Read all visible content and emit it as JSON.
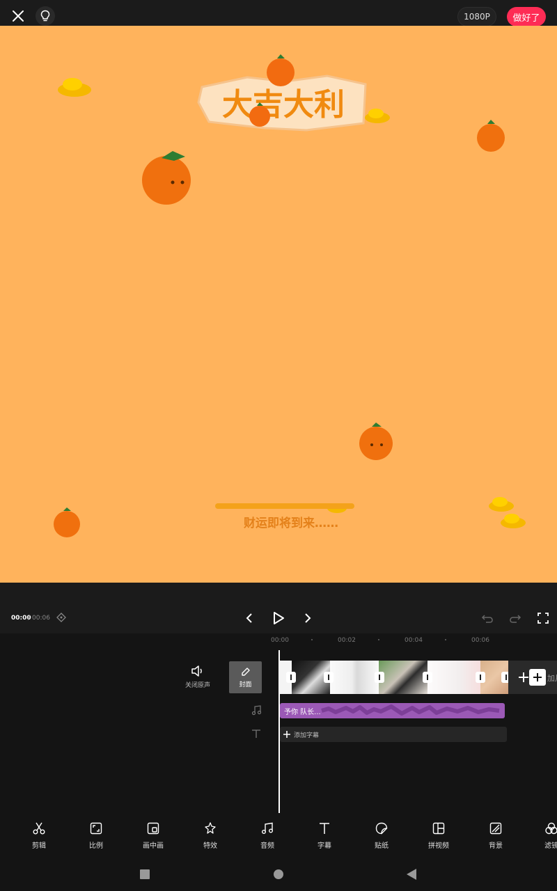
{
  "topbar": {
    "close_icon": "close-icon",
    "tips_icon": "lightbulb-icon",
    "resolution_label": "1080P",
    "done_label": "做好了",
    "done_color": "#fe2c55"
  },
  "preview": {
    "background_color": "#ffb35c",
    "banner_text": "大吉大利",
    "caption_text": "财运即将到来……"
  },
  "playback": {
    "current_time": "00:00",
    "separator": "/",
    "total_time": "00:06",
    "keyframe_icon": "keyframe-diamond-icon",
    "prev_icon": "chevron-left-icon",
    "play_icon": "play-icon",
    "next_icon": "chevron-right-icon",
    "undo_icon": "undo-icon",
    "redo_icon": "redo-icon",
    "fullscreen_icon": "fullscreen-icon"
  },
  "timeline": {
    "ticks": [
      "00:00",
      "00:02",
      "00:04",
      "00:06"
    ],
    "mute_label": "关闭原声",
    "cover_label": "封面",
    "add_clip_label": "加片段",
    "audio_label": "予你 队长...",
    "audio_color": "#9b59b6",
    "subtitle_label": "添加字幕"
  },
  "toolbar": {
    "items": [
      {
        "label": "剪辑",
        "icon": "scissors-icon"
      },
      {
        "label": "比例",
        "icon": "aspect-ratio-icon"
      },
      {
        "label": "画中画",
        "icon": "picture-in-picture-icon"
      },
      {
        "label": "特效",
        "icon": "effects-star-icon"
      },
      {
        "label": "音频",
        "icon": "music-icon"
      },
      {
        "label": "字幕",
        "icon": "text-icon"
      },
      {
        "label": "贴纸",
        "icon": "sticker-icon"
      },
      {
        "label": "拼视频",
        "icon": "split-layout-icon"
      },
      {
        "label": "背景",
        "icon": "background-icon"
      },
      {
        "label": "滤镜",
        "icon": "filter-icon"
      }
    ]
  },
  "navbar": {
    "recents_icon": "recents-square-icon",
    "home_icon": "home-circle-icon",
    "back_icon": "back-triangle-icon"
  }
}
